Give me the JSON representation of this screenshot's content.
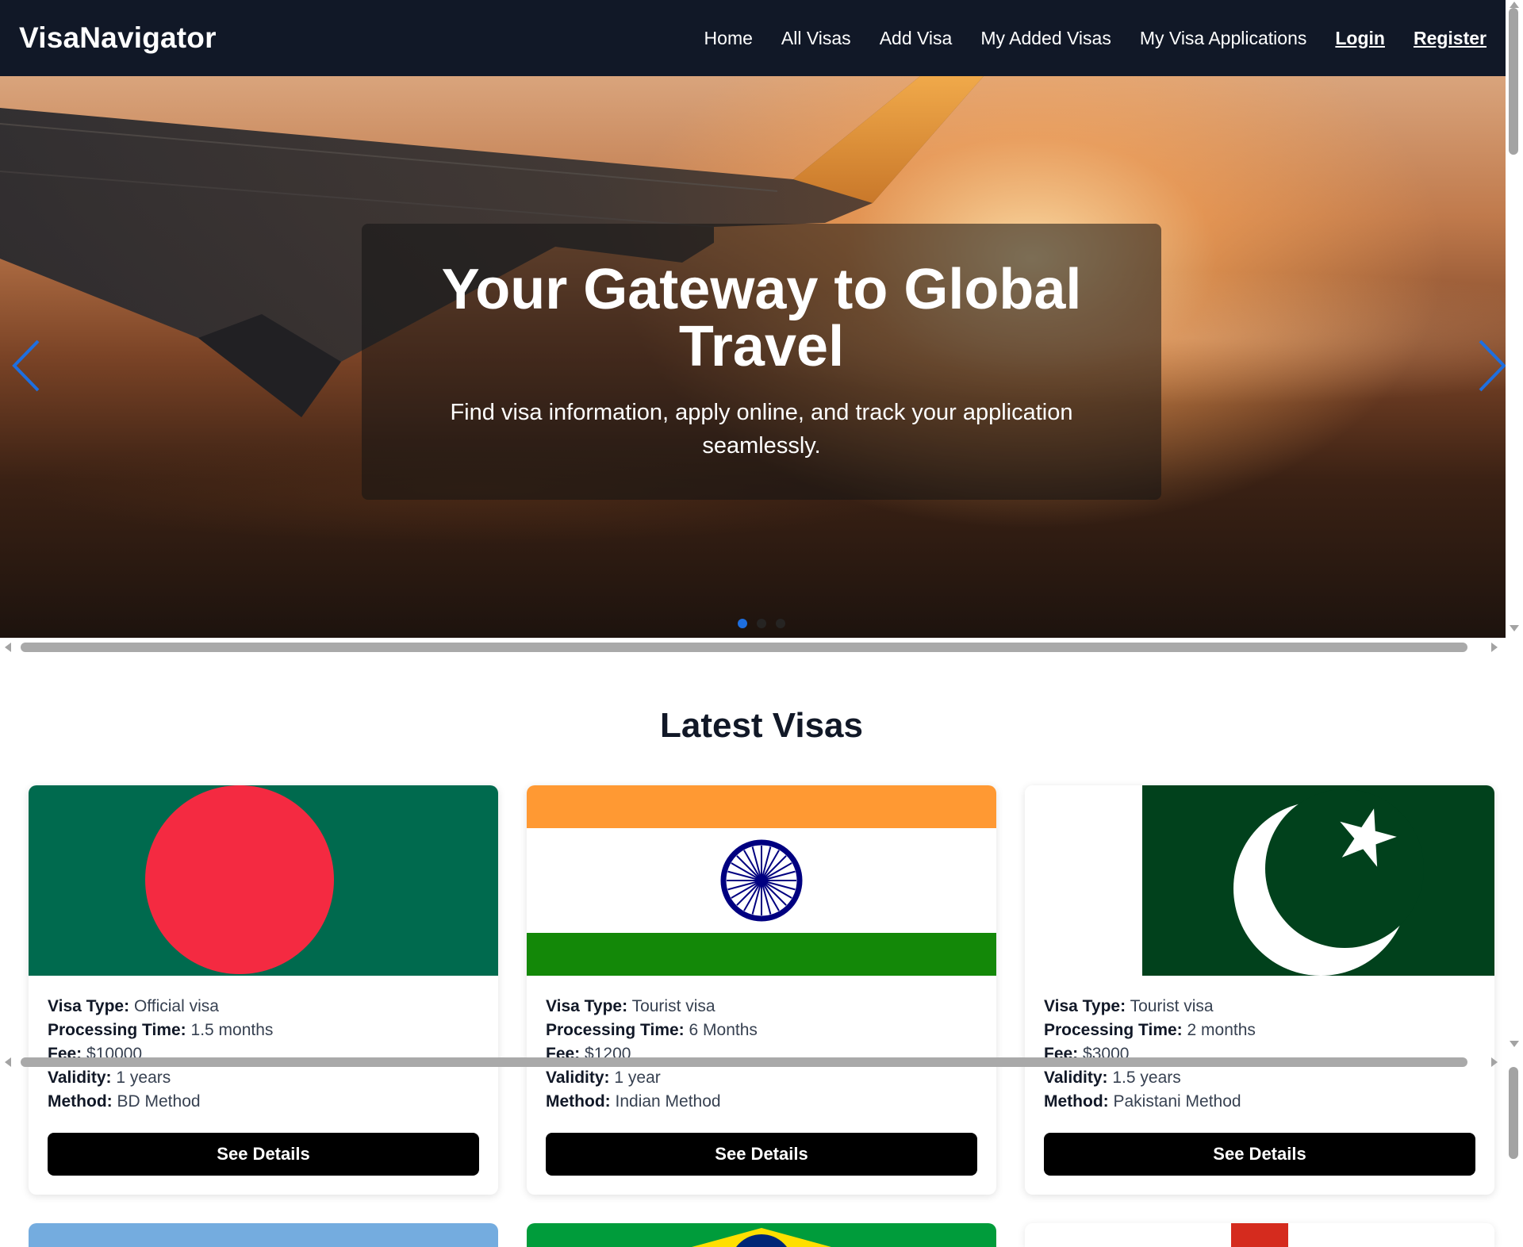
{
  "brand": "VisaNavigator",
  "nav": {
    "home": "Home",
    "all_visas": "All Visas",
    "add_visa": "Add Visa",
    "my_added_visas": "My Added Visas",
    "my_visa_applications": "My Visa Applications",
    "login": "Login",
    "register": "Register"
  },
  "hero": {
    "title": "Your Gateway to Global Travel",
    "subtitle": "Find visa information, apply online, and track your application seamlessly.",
    "active_slide": 1,
    "slide_count": 3
  },
  "section_title": "Latest Visas",
  "labels": {
    "visa_type": "Visa Type:",
    "processing_time": "Processing Time:",
    "fee": "Fee:",
    "validity": "Validity:",
    "method": "Method:",
    "see_details": "See Details"
  },
  "cards": [
    {
      "country_flag": "bangladesh-flag",
      "visa_type": "Official visa",
      "processing_time": "1.5 months",
      "fee": "$10000",
      "validity": "1 years",
      "method": "BD Method"
    },
    {
      "country_flag": "india-flag",
      "visa_type": "Tourist visa",
      "processing_time": "6 Months",
      "fee": "$1200",
      "validity": "1 year",
      "method": "Indian Method"
    },
    {
      "country_flag": "pakistan-flag",
      "visa_type": "Tourist visa",
      "processing_time": "2 months",
      "fee": "$3000",
      "validity": "1.5 years",
      "method": "Pakistani Method"
    }
  ],
  "colors": {
    "navbar": "#111827",
    "button": "#000000",
    "active_dot": "#1e6fe0",
    "carousel_arrow": "#1e6fe0"
  }
}
